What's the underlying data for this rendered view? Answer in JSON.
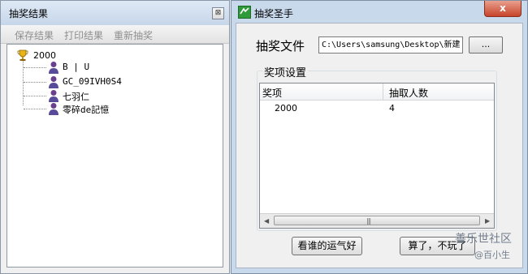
{
  "results_window": {
    "title": "抽奖结果",
    "close_glyph": "⊠",
    "menu": [
      "保存结果",
      "打印结果",
      "重新抽奖"
    ],
    "tree": {
      "root_label": "2000",
      "root_icon": "trophy-icon",
      "children": [
        {
          "label": "B | U",
          "icon": "user-icon"
        },
        {
          "label": "GC_09IVH0S4",
          "icon": "user-icon"
        },
        {
          "label": "七羽仁",
          "icon": "user-icon"
        },
        {
          "label": "零碎de記憶",
          "icon": "user-icon"
        }
      ]
    }
  },
  "main_window": {
    "title": "抽奖圣手",
    "close_glyph": "x",
    "file_label": "抽奖文件",
    "file_path": "C:\\Users\\samsung\\Desktop\\新建",
    "browse_label": "...",
    "group_label": "奖项设置",
    "list": {
      "columns": [
        "奖项",
        "抽取人数"
      ],
      "rows": [
        {
          "prize": "2000",
          "count": "4"
        }
      ]
    },
    "buttons": {
      "draw": "看谁的运气好",
      "quit": "算了，不玩了"
    }
  },
  "watermark": {
    "line1": "善乐世社区",
    "line2": "@百小生"
  },
  "colors": {
    "titlebar": "#c9d9ec",
    "close_red": "#c8442b",
    "menu_disabled": "#8f8f8f"
  }
}
